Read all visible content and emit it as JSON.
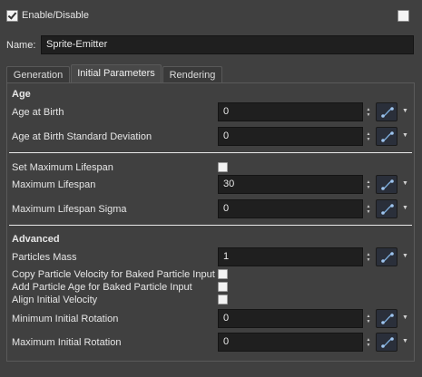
{
  "header": {
    "enable_label": "Enable/Disable",
    "name_label": "Name:",
    "name_value": "Sprite-Emitter"
  },
  "tabs": [
    "Generation",
    "Initial Parameters",
    "Rendering"
  ],
  "sections": {
    "age": "Age",
    "advanced": "Advanced"
  },
  "rows": {
    "age_at_birth": {
      "label": "Age at Birth",
      "value": "0"
    },
    "age_std": {
      "label": "Age at Birth Standard Deviation",
      "value": "0"
    },
    "set_max_life": {
      "label": "Set Maximum Lifespan"
    },
    "max_life": {
      "label": "Maximum Lifespan",
      "value": "30"
    },
    "max_life_sigma": {
      "label": "Maximum Lifespan Sigma",
      "value": "0"
    },
    "mass": {
      "label": "Particles Mass",
      "value": "1"
    },
    "copy_vel": {
      "label": "Copy Particle Velocity for Baked Particle Input"
    },
    "add_age": {
      "label": "Add Particle Age for Baked Particle Input"
    },
    "align_vel": {
      "label": "Align Initial Velocity"
    },
    "min_rot": {
      "label": "Minimum Initial Rotation",
      "value": "0"
    },
    "max_rot": {
      "label": "Maximum Initial Rotation",
      "value": "0"
    }
  },
  "icons": {
    "spin": "spin-arrows-icon",
    "fn": "function-curve-icon",
    "dropdown": "dropdown-caret-icon"
  }
}
